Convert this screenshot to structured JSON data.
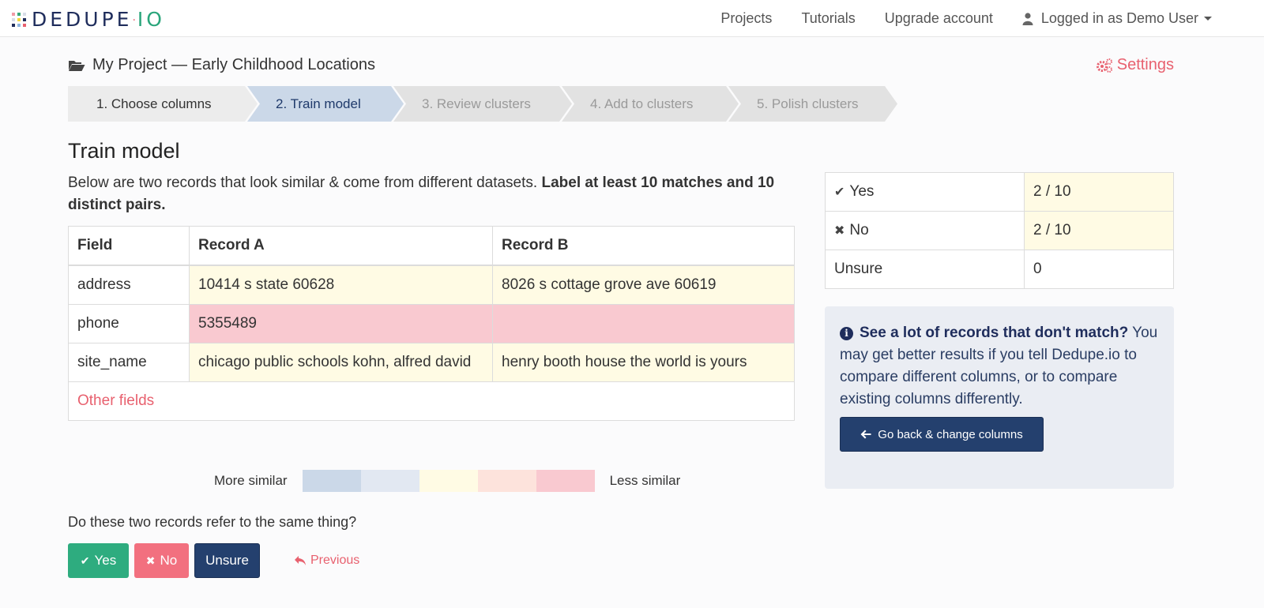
{
  "brand": {
    "name": "DEDUPE",
    "separator": "·",
    "suffix": "IO",
    "logo_colors": [
      "#f19aa6",
      "#3aaa7c",
      "#d8dde8",
      "#d8dde8",
      "#f5d83a",
      "#1f2d5c",
      "#1f2d5c",
      "#8fb6e0",
      "#e8616f"
    ]
  },
  "nav": {
    "items": [
      {
        "label": "Projects"
      },
      {
        "label": "Tutorials"
      },
      {
        "label": "Upgrade account"
      }
    ],
    "user_menu": {
      "label": "Logged in as Demo User",
      "icon": "user-icon"
    }
  },
  "project": {
    "title": "My Project — Early Childhood Locations",
    "icon": "folder-open-icon",
    "settings_label": "Settings",
    "settings_icon": "gears-icon"
  },
  "steps": [
    {
      "label": "1. Choose columns",
      "state": "done"
    },
    {
      "label": "2. Train model",
      "state": "active"
    },
    {
      "label": "3. Review clusters",
      "state": "upcoming"
    },
    {
      "label": "4. Add to clusters",
      "state": "upcoming"
    },
    {
      "label": "5. Polish clusters",
      "state": "upcoming"
    }
  ],
  "main": {
    "title": "Train model",
    "intro_text": "Below are two records that look similar & come from different datasets. ",
    "intro_bold": "Label at least 10 matches and 10 distinct pairs.",
    "table": {
      "headers": [
        "Field",
        "Record A",
        "Record B"
      ],
      "rows": [
        {
          "field": "address",
          "record_a": "10414 s state 60628",
          "record_b": "8026 s cottage grove ave 60619",
          "similarity": "medium"
        },
        {
          "field": "phone",
          "record_a": "5355489",
          "record_b": "",
          "similarity": "least"
        },
        {
          "field": "site_name",
          "record_a": "chicago public schools kohn, alfred david",
          "record_b": "henry booth house the world is yours",
          "similarity": "medium"
        }
      ],
      "other_fields_label": "Other fields"
    },
    "legend": {
      "more_label": "More similar",
      "less_label": "Less similar",
      "colors": [
        "#cbd8e8",
        "#e2e8f2",
        "#fffbe4",
        "#fde3dc",
        "#f9c9d0"
      ]
    },
    "question": "Do these two records refer to the same thing?",
    "buttons": {
      "yes": "Yes",
      "no": "No",
      "unsure": "Unsure",
      "previous": "Previous"
    }
  },
  "stats": {
    "rows": [
      {
        "label": "Yes",
        "icon": "check-icon",
        "value": "2 / 10"
      },
      {
        "label": "No",
        "icon": "times-icon",
        "value": "2 / 10"
      },
      {
        "label": "Unsure",
        "icon": "",
        "value": "0"
      }
    ]
  },
  "info": {
    "bold": "See a lot of records that don't match?",
    "text": " You may get better results if you tell Dedupe.io to compare different columns, or to compare existing columns differently.",
    "button_label": "Go back & change columns"
  },
  "colors": {
    "accent_red": "#e8616f",
    "navy": "#24406e",
    "green": "#2eac7f",
    "pink_button": "#f2707f"
  }
}
